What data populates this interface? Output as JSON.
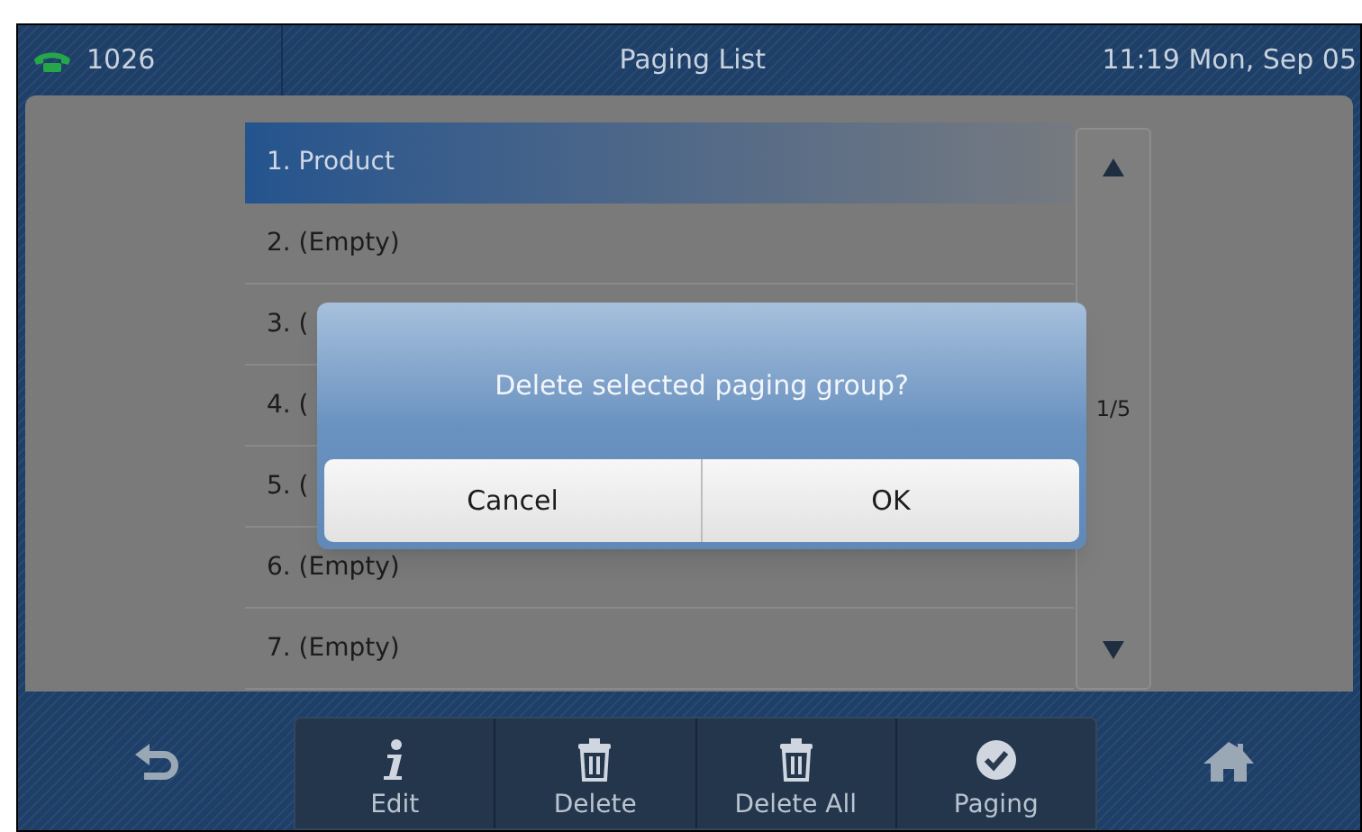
{
  "status_bar": {
    "line": "1026",
    "title": "Paging List",
    "datetime": "11:19 Mon, Sep 05"
  },
  "list": {
    "items": [
      {
        "label": "1. Product",
        "selected": true
      },
      {
        "label": "2. (Empty)",
        "selected": false
      },
      {
        "label": "3. (",
        "selected": false
      },
      {
        "label": "4. (",
        "selected": false
      },
      {
        "label": "5. (",
        "selected": false
      },
      {
        "label": "6. (Empty)",
        "selected": false
      },
      {
        "label": "7. (Empty)",
        "selected": false
      }
    ],
    "page": "1/5"
  },
  "dialog": {
    "message": "Delete selected paging group?",
    "buttons": [
      "Cancel",
      "OK"
    ]
  },
  "softkeys": [
    {
      "kind": "edit",
      "label": "Edit"
    },
    {
      "kind": "delete",
      "label": "Delete"
    },
    {
      "kind": "delete",
      "label": "Delete All"
    },
    {
      "kind": "check",
      "label": "Paging"
    }
  ]
}
